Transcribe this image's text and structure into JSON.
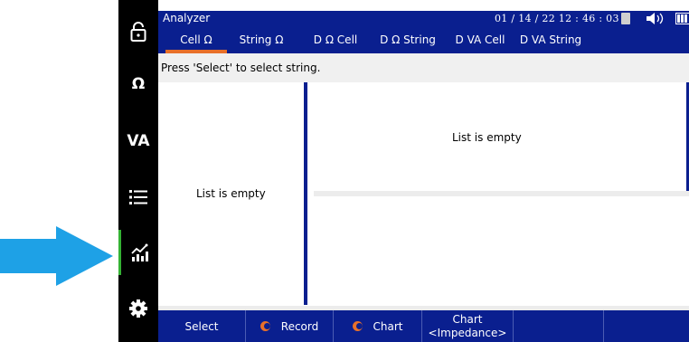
{
  "statusbar": {
    "app_title": "Analyzer",
    "datetime": "01 / 14 / 22  12 : 46 : 03"
  },
  "sidebar": {
    "items": [
      {
        "name": "lock",
        "icon": "lock-icon"
      },
      {
        "name": "ohm",
        "label": "Ω"
      },
      {
        "name": "va",
        "label": "VA"
      },
      {
        "name": "list",
        "icon": "list-icon"
      },
      {
        "name": "chart",
        "icon": "chart-icon",
        "active": true
      },
      {
        "name": "settings",
        "icon": "gear-icon"
      }
    ]
  },
  "tabs": [
    {
      "label": "Cell Ω",
      "active": true
    },
    {
      "label": "String Ω"
    },
    {
      "label": "D Ω Cell"
    },
    {
      "label": "D Ω String"
    },
    {
      "label": "D VA Cell"
    },
    {
      "label": "D VA String"
    }
  ],
  "message": "Press 'Select' to select string.",
  "lists": {
    "left_empty": "List is empty",
    "right_top_empty": "List is empty"
  },
  "softkeys": {
    "select": "Select",
    "record": "Record",
    "chart": "Chart",
    "chart_impedance_line1": "Chart",
    "chart_impedance_line2": "<Impedance>"
  },
  "colors": {
    "header_blue": "#0a1f8f",
    "accent_orange": "#e8702a",
    "active_green": "#34b233",
    "annotation_arrow": "#1ea1e6"
  }
}
